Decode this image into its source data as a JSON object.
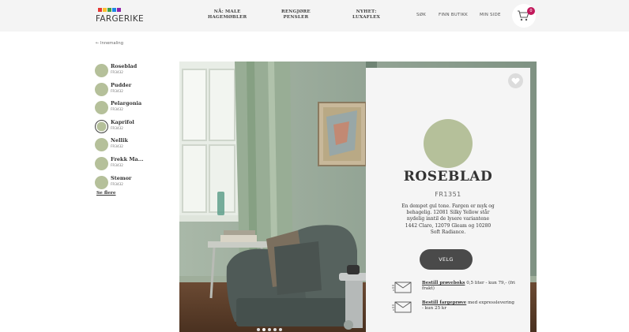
{
  "header": {
    "logo_text": "FARGERIKE",
    "logo_colors": [
      "#e53935",
      "#fbc02d",
      "#43a047",
      "#1e88e5",
      "#8e24aa"
    ],
    "nav": [
      {
        "line1": "NÅ: MALE",
        "line2": "HAGEMØBLER"
      },
      {
        "line1": "RENGJØRE",
        "line2": "PENSLER"
      },
      {
        "line1": "NYHET:",
        "line2": "LUXAFLEX"
      }
    ],
    "utility": {
      "search": "SØK",
      "find_store": "FINN BUTIKK",
      "my_page": "MIN SIDE"
    },
    "cart_count": "0"
  },
  "breadcrumb": "← Innemaling",
  "swatches": [
    {
      "name": "Roseblad",
      "code": "FR3432",
      "color": "#b5c09a"
    },
    {
      "name": "Pudder",
      "code": "FR3432",
      "color": "#b5c09a"
    },
    {
      "name": "Pelargonia",
      "code": "FR3432",
      "color": "#b5c09a"
    },
    {
      "name": "Kaprifol",
      "code": "FR3432",
      "color": "#b5c09a",
      "selected": true
    },
    {
      "name": "Nellik",
      "code": "FR3432",
      "color": "#b5c09a"
    },
    {
      "name": "Frekk Ma...",
      "code": "FR3432",
      "color": "#b5c09a"
    },
    {
      "name": "Stemor",
      "code": "FR3432",
      "color": "#b5c09a"
    }
  ],
  "see_more": "Se flere",
  "card": {
    "swatch_color": "#b5c09a",
    "name": "ROSEBLAD",
    "code": "FR1351",
    "description": "En dempet gul tone. Fargen er myk og behagelig. 12081 Silky Yellow står nydelig inntil de lysere variantene 1442 Claro, 12079 Gleam og 10280 Soft Radiance.",
    "button": "VELG",
    "order_sample_link": "Bestill prøveboks",
    "order_sample_rest": " 0,5 liter - kun 79,- (fri frakt)",
    "order_card_link": "Bestill fargeprøve",
    "order_card_rest": " med expresslevering - kun 25 kr"
  }
}
